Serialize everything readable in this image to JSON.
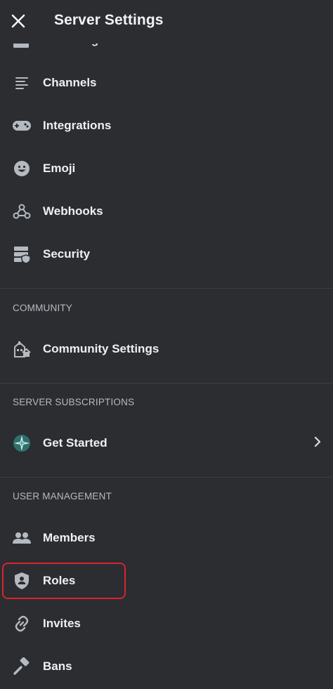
{
  "header": {
    "title": "Server Settings",
    "close_icon": "close-icon"
  },
  "partial_item": {
    "label": "Audit Log",
    "icon": "audit-log-icon"
  },
  "items": [
    {
      "label": "Channels",
      "icon": "channels-icon"
    },
    {
      "label": "Integrations",
      "icon": "gamepad-icon"
    },
    {
      "label": "Emoji",
      "icon": "emoji-icon"
    },
    {
      "label": "Webhooks",
      "icon": "webhook-icon"
    },
    {
      "label": "Security",
      "icon": "security-icon"
    }
  ],
  "community": {
    "heading": "COMMUNITY",
    "items": [
      {
        "label": "Community Settings",
        "icon": "community-icon"
      }
    ]
  },
  "subscriptions": {
    "heading": "SERVER SUBSCRIPTIONS",
    "items": [
      {
        "label": "Get Started",
        "icon": "compass-star-icon",
        "accent": "#3ba7a0"
      }
    ]
  },
  "user_management": {
    "heading": "USER MANAGEMENT",
    "items": [
      {
        "label": "Members",
        "icon": "members-icon"
      },
      {
        "label": "Roles",
        "icon": "shield-role-icon"
      },
      {
        "label": "Invites",
        "icon": "link-icon"
      },
      {
        "label": "Bans",
        "icon": "hammer-icon"
      }
    ]
  },
  "colors": {
    "background": "#2b2d31",
    "text": "#f2f3f5",
    "muted": "#b5bac1",
    "highlight": "#d9232e"
  }
}
